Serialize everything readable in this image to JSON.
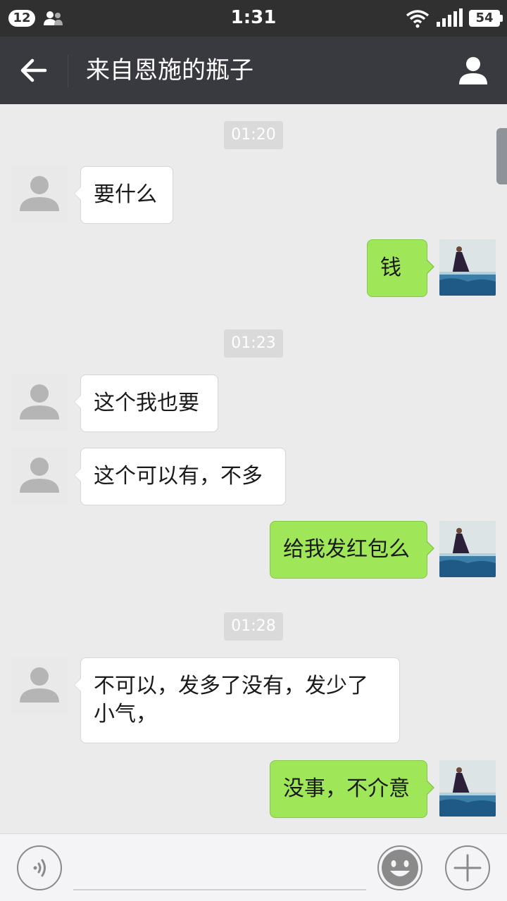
{
  "status_bar": {
    "notification_count": "12",
    "time": "1:31",
    "battery": "54",
    "icons": [
      "contacts-icon",
      "wifi-icon",
      "signal-icon",
      "battery-icon"
    ]
  },
  "header": {
    "title": "来自恩施的瓶子",
    "back_icon": "back-arrow-icon",
    "profile_icon": "person-icon"
  },
  "messages": {
    "ts1": "01:20",
    "m1": "要什么",
    "m2": "钱",
    "ts2": "01:23",
    "m3": "这个我也要",
    "m4": "这个可以有，不多",
    "m5": "给我发红包么",
    "ts3": "01:28",
    "m6": "不可以，发多了没有，发少了小气，",
    "m7": "没事，不介意"
  },
  "input_bar": {
    "text_value": "",
    "icons": [
      "voice-icon",
      "emoji-icon",
      "plus-icon"
    ]
  },
  "colors": {
    "status_bar_bg": "#303030",
    "title_bar_bg": "#393a3f",
    "chat_bg": "#ebebeb",
    "outgoing_bubble": "#9fe658",
    "incoming_bubble": "#ffffff"
  }
}
